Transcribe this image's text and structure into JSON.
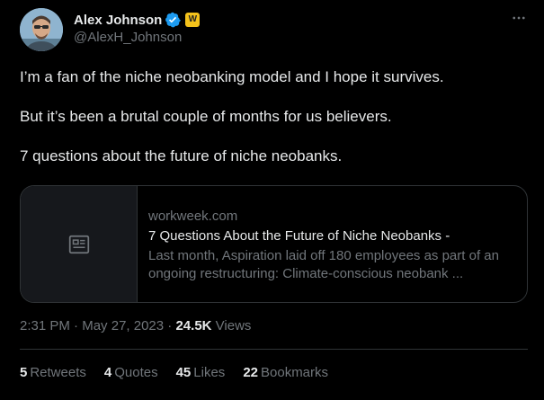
{
  "author": {
    "display_name": "Alex Johnson",
    "handle": "@AlexH_Johnson",
    "verified_icon": "verified-badge-icon",
    "org_badge_letter": "W",
    "org_badge_color": "#f4c21b",
    "verified_color": "#1d9bf0"
  },
  "tweet": {
    "paragraphs": [
      "I’m a fan of the niche neobanking model and I hope it survives.",
      "But it’s been a brutal couple of months for us believers.",
      "7 questions about the future of niche neobanks."
    ]
  },
  "card": {
    "domain": "workweek.com",
    "title": "7 Questions About the Future of Niche Neobanks -",
    "description": "Last month, Aspiration laid off 180 employees as part of an ongoing restructuring: Climate-conscious neobank ...",
    "thumbnail_icon": "article-placeholder-icon"
  },
  "meta": {
    "time": "2:31 PM",
    "separator": " · ",
    "date": "May 27, 2023",
    "views_count": "24.5K",
    "views_label": "Views"
  },
  "stats": {
    "retweets_count": "5",
    "retweets_label": "Retweets",
    "quotes_count": "4",
    "quotes_label": "Quotes",
    "likes_count": "45",
    "likes_label": "Likes",
    "bookmarks_count": "22",
    "bookmarks_label": "Bookmarks"
  },
  "colors": {
    "background": "#000000",
    "text_primary": "#e7e9ea",
    "text_secondary": "#71767b",
    "border": "#2f3336"
  }
}
